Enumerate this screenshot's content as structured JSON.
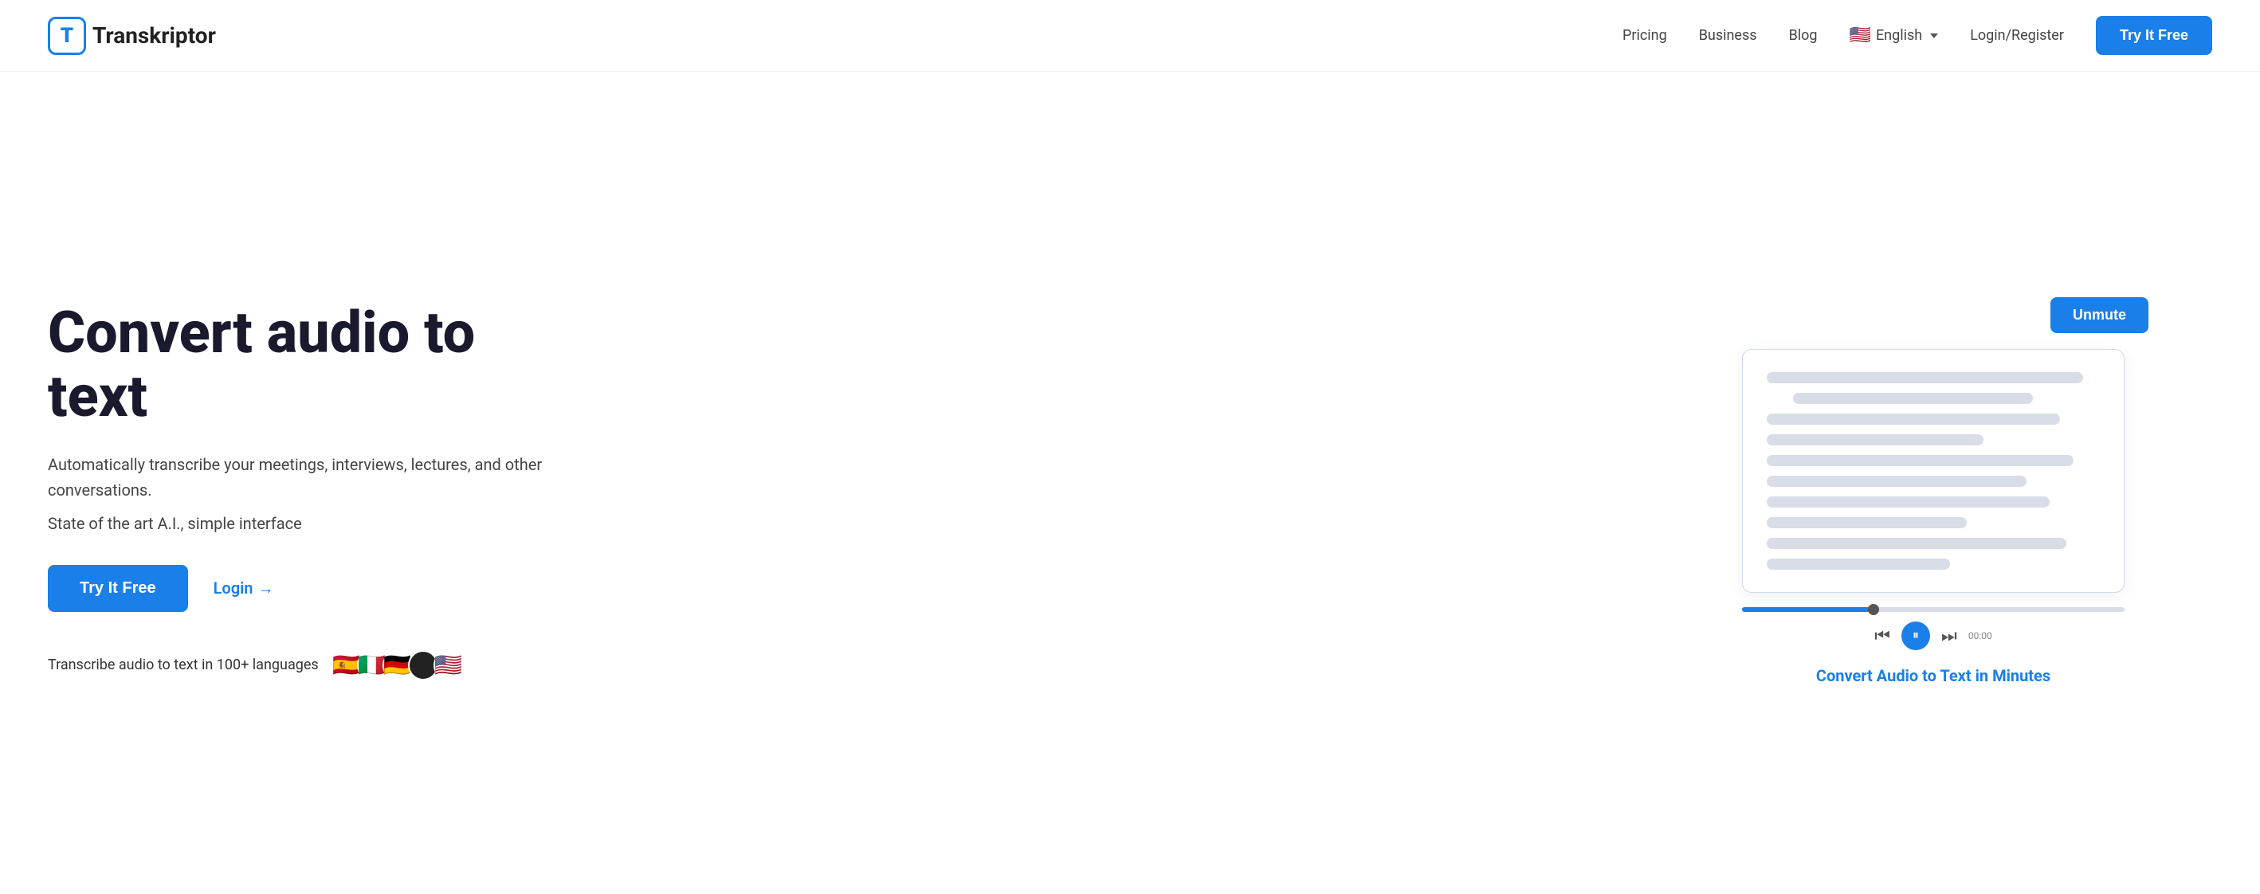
{
  "nav": {
    "logo_letter": "T",
    "logo_name_prefix": "",
    "logo_name": "Transkriptor",
    "links": [
      {
        "label": "Pricing",
        "id": "pricing"
      },
      {
        "label": "Business",
        "id": "business"
      },
      {
        "label": "Blog",
        "id": "blog"
      }
    ],
    "language": {
      "label": "English",
      "flag": "🇺🇸"
    },
    "login_label": "Login/Register",
    "cta_label": "Try It Free"
  },
  "hero": {
    "title": "Convert audio to text",
    "desc": "Automatically transcribe your meetings, interviews, lectures, and other conversations.",
    "subtitle": "State of the art A.I., simple interface",
    "try_btn": "Try It Free",
    "login_btn": "Login",
    "login_arrow": "→",
    "languages_text": "Transcribe audio to text in 100+ languages",
    "language_flags": [
      "🇪🇸",
      "🇮🇹",
      "🇩🇪",
      "⚫",
      "🇺🇸"
    ],
    "unmute_btn": "Unmute",
    "convert_label": "Convert Audio to Text in Minutes",
    "audio_time": "00:00"
  }
}
